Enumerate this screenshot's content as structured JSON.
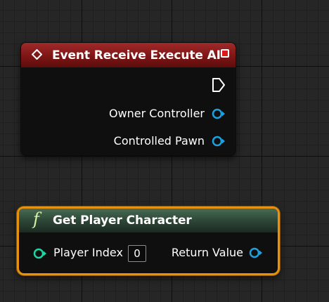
{
  "event_node": {
    "title": "Event Receive Execute AI",
    "header_color": "#8b1a1a",
    "outputs": [
      {
        "label": "Owner Controller",
        "pin_type": "object-reference",
        "pin_color": "#1ea0e0"
      },
      {
        "label": "Controlled Pawn",
        "pin_type": "object-reference",
        "pin_color": "#1ea0e0"
      }
    ],
    "exec_output_icon": "exec-pin-icon",
    "delegate_icon": "delegate-pin-icon"
  },
  "function_node": {
    "icon_glyph": "f",
    "title": "Get Player Character",
    "header_color": "#3a5a45",
    "selection_color": "#e8920c",
    "inputs": [
      {
        "label": "Player Index",
        "value": "0",
        "pin_type": "integer",
        "pin_color": "#1fd5a4"
      }
    ],
    "outputs": [
      {
        "label": "Return Value",
        "pin_type": "object-reference",
        "pin_color": "#1ea0e0"
      }
    ]
  }
}
